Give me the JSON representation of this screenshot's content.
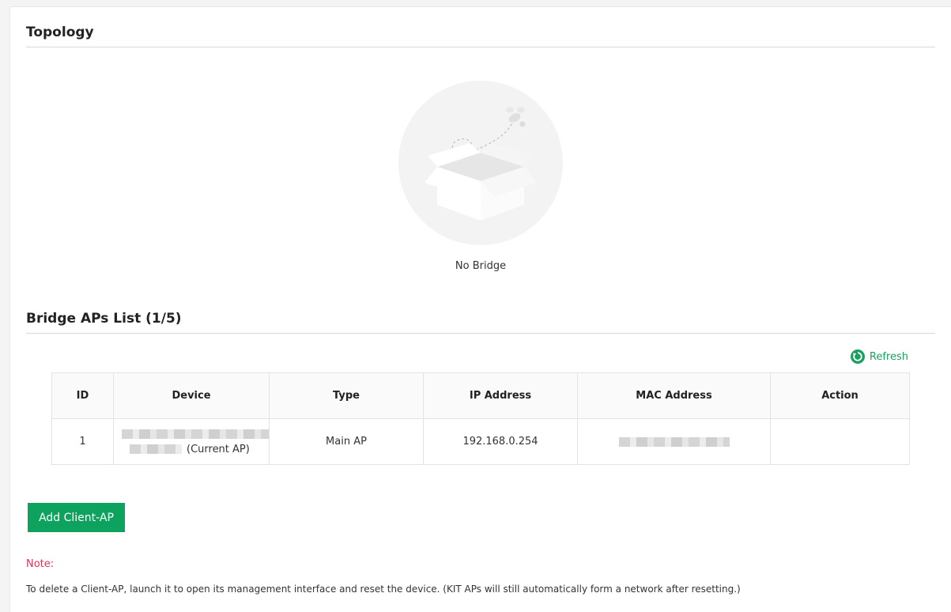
{
  "topology": {
    "title": "Topology",
    "empty_text": "No Bridge",
    "illustration_icon": "empty-box-icon"
  },
  "bridge_list": {
    "title": "Bridge APs List (1/5)",
    "refresh_label": "Refresh",
    "refresh_icon": "refresh-icon",
    "accent_color": "#1aa05f",
    "columns": [
      "ID",
      "Device",
      "Type",
      "IP Address",
      "MAC Address",
      "Action"
    ],
    "rows": [
      {
        "id": "1",
        "device_suffix": "(Current AP)",
        "type": "Main AP",
        "ip": "192.168.0.254",
        "action": ""
      }
    ]
  },
  "actions": {
    "add_client_ap": "Add Client-AP",
    "button_color": "#0da35e"
  },
  "note": {
    "label": "Note:",
    "text": "To delete a Client-AP, launch it to open its management interface and reset the device. (KIT APs will still automatically form a network after resetting.)",
    "label_color": "#e0335c"
  }
}
